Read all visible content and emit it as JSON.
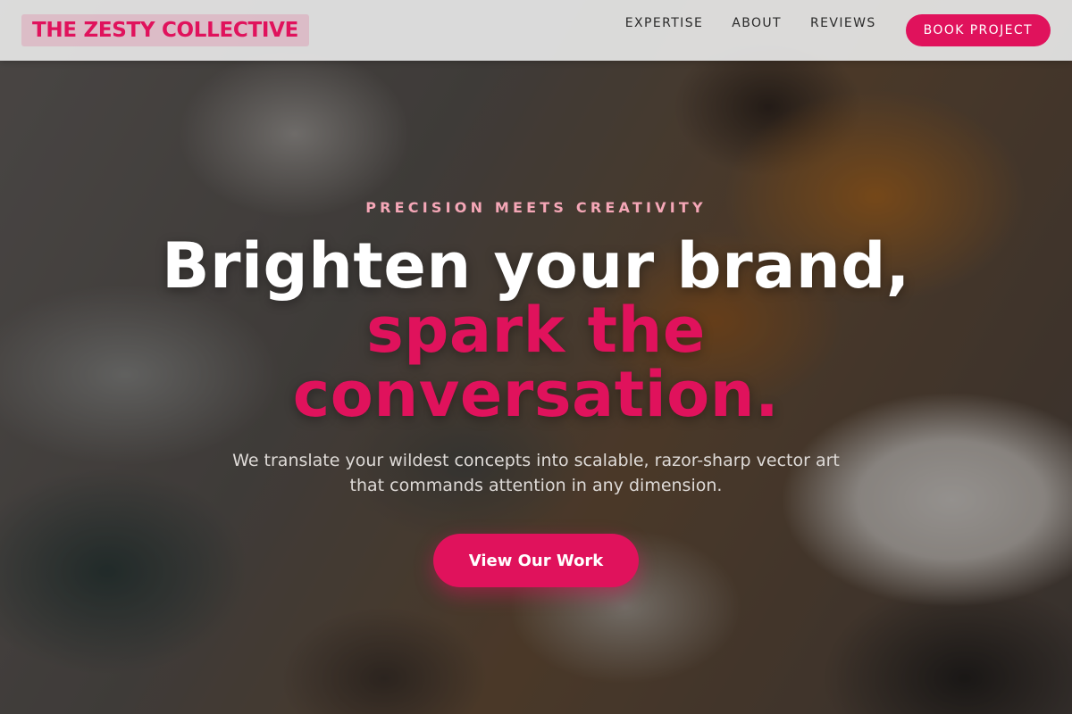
{
  "header": {
    "logo": "THE ZESTY COLLECTIVE",
    "nav": [
      {
        "label": "EXPERTISE"
      },
      {
        "label": "ABOUT"
      },
      {
        "label": "REVIEWS"
      }
    ],
    "book_label": "BOOK PROJECT"
  },
  "hero": {
    "eyebrow": "PRECISION MEETS CREATIVITY",
    "headline_plain": "Brighten your brand,",
    "headline_accent": "spark the conversation.",
    "subtext": "We translate your wildest concepts into scalable, razor-sharp vector art that commands attention in any dimension.",
    "cta_label": "View Our Work"
  },
  "colors": {
    "accent": "#e0125c",
    "eyebrow": "#f5a7b7",
    "header_bg": "#e6e6e6",
    "nav_text": "#2a2a2a",
    "headline_text": "#ffffff",
    "subtext": "#dedad7"
  },
  "background": {
    "description_icon": "painted-texture-background"
  }
}
